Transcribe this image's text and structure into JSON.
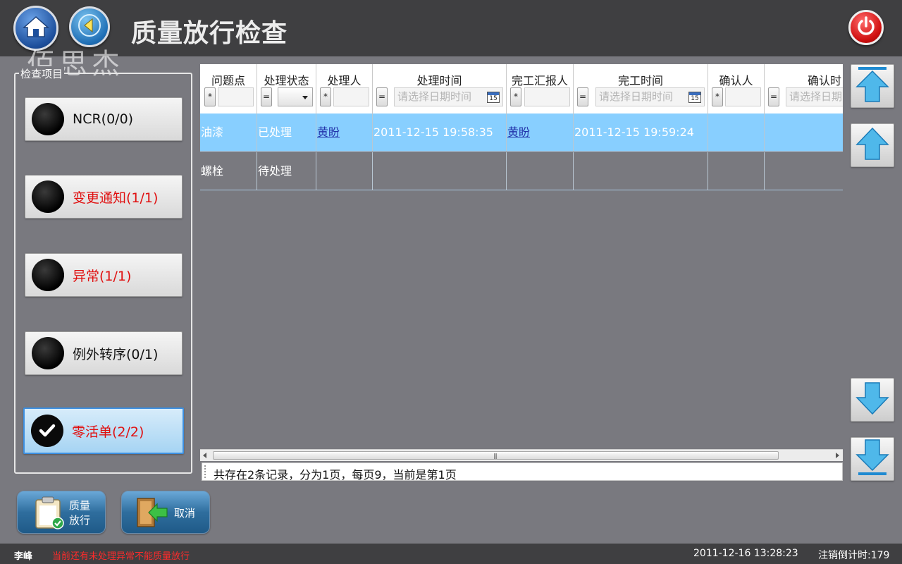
{
  "header": {
    "title": "质量放行检查",
    "watermark": "佰思杰"
  },
  "check_panel": {
    "legend": "检查项目",
    "items": [
      {
        "label": "NCR(0/0)",
        "color": "#111111",
        "selected": false
      },
      {
        "label": "变更通知(1/1)",
        "color": "#e01010",
        "selected": false
      },
      {
        "label": "异常(1/1)",
        "color": "#e01010",
        "selected": false
      },
      {
        "label": "例外转序(0/1)",
        "color": "#111111",
        "selected": false
      },
      {
        "label": "零活单(2/2)",
        "color": "#e01010",
        "selected": true
      }
    ]
  },
  "grid": {
    "columns": [
      {
        "title": "问题点",
        "op": "*"
      },
      {
        "title": "处理状态",
        "op": "="
      },
      {
        "title": "处理人",
        "op": "*"
      },
      {
        "title": "处理时间",
        "op": "=",
        "placeholder": "请选择日期时间",
        "calendar_day": "15"
      },
      {
        "title": "完工汇报人",
        "op": "*"
      },
      {
        "title": "完工时间",
        "op": "=",
        "placeholder": "请选择日期时间",
        "calendar_day": "15"
      },
      {
        "title": "确认人",
        "op": "*"
      },
      {
        "title": "确认时",
        "op": "=",
        "placeholder": "请选择日期"
      }
    ],
    "rows": [
      {
        "selected": true,
        "cells": [
          "油漆",
          "已处理",
          "黄盼",
          "2011-12-15 19:58:35",
          "黄盼",
          "2011-12-15 19:59:24",
          "",
          ""
        ]
      },
      {
        "selected": false,
        "cells": [
          "螺栓",
          "待处理",
          "",
          "",
          "",
          "",
          "",
          ""
        ]
      }
    ],
    "pager_text": "共存在2条记录，分为1页，每页9，当前是第1页"
  },
  "actions": {
    "release_label_1": "质量",
    "release_label_2": "放行",
    "cancel_label": "取消"
  },
  "status": {
    "user": "李峰",
    "warning": "当前还有未处理异常不能质量放行",
    "datetime": "2011-12-16 13:28:23",
    "countdown": "注销倒计时:179"
  },
  "icons": {
    "home": "home-icon",
    "back": "back-arrow-icon",
    "power": "power-icon",
    "scroll_top": "arrow-up-to-top-icon",
    "scroll_up": "arrow-up-icon",
    "scroll_down": "arrow-down-icon",
    "scroll_bottom": "arrow-down-to-bottom-icon",
    "release": "clipboard-check-icon",
    "cancel": "door-exit-icon"
  },
  "colors": {
    "accent_blue": "#88cfff",
    "warning_red": "#ff2b2b"
  }
}
